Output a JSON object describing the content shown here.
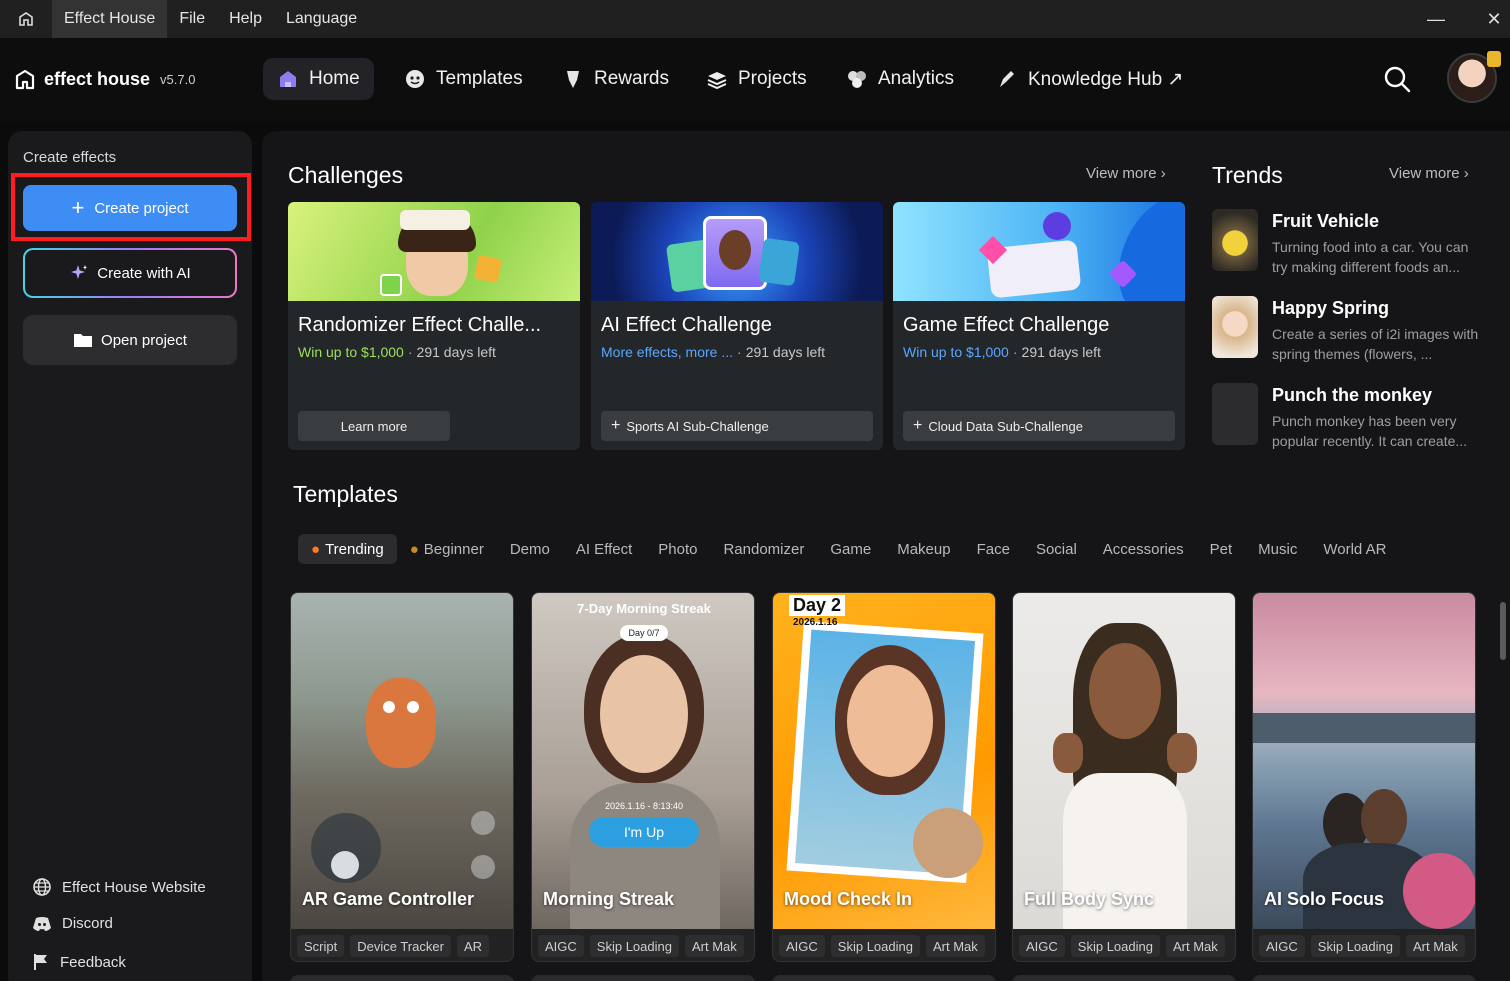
{
  "titlebar": {
    "menus": [
      "Effect House",
      "File",
      "Help",
      "Language"
    ],
    "minimize": "—",
    "close": "✕"
  },
  "header": {
    "logo_name": "effect house",
    "version": "v5.7.0",
    "nav": [
      {
        "label": "Home",
        "icon": "home-icon",
        "active": true
      },
      {
        "label": "Templates",
        "icon": "templates-icon"
      },
      {
        "label": "Rewards",
        "icon": "rewards-icon"
      },
      {
        "label": "Projects",
        "icon": "projects-icon"
      },
      {
        "label": "Analytics",
        "icon": "analytics-icon"
      },
      {
        "label": "Knowledge Hub ↗",
        "icon": "knowledge-hub-icon"
      }
    ]
  },
  "sidebar": {
    "title": "Create effects",
    "create_project": "Create project",
    "create_ai": "Create with AI",
    "open_project": "Open project",
    "links": [
      {
        "label": "Effect House Website",
        "icon": "globe-icon"
      },
      {
        "label": "Discord",
        "icon": "discord-icon"
      },
      {
        "label": "Feedback",
        "icon": "flag-icon"
      }
    ]
  },
  "challenges": {
    "title": "Challenges",
    "view_more": "View more",
    "cards": [
      {
        "title": "Randomizer Effect Challe...",
        "reward": "Win up to $1,000",
        "days": "291 days left",
        "button": "Learn more"
      },
      {
        "title": "AI Effect Challenge",
        "reward": "More effects, more ...",
        "days": "291 days left",
        "button": "Sports AI Sub-Challenge"
      },
      {
        "title": "Game Effect Challenge",
        "reward": "Win up to $1,000",
        "days": "291 days left",
        "button": "Cloud Data Sub-Challenge"
      }
    ]
  },
  "trends": {
    "title": "Trends",
    "view_more": "View more",
    "items": [
      {
        "title": "Fruit Vehicle",
        "desc": "Turning food into a car. You can try making different foods an..."
      },
      {
        "title": "Happy Spring",
        "desc": "Create a series of i2i images with spring themes (flowers, ..."
      },
      {
        "title": "Punch the monkey",
        "desc": "Punch monkey has been very popular recently. It can create..."
      }
    ]
  },
  "templates": {
    "title": "Templates",
    "tabs": [
      "Trending",
      "Beginner",
      "Demo",
      "AI Effect",
      "Photo",
      "Randomizer",
      "Game",
      "Makeup",
      "Face",
      "Social",
      "Accessories",
      "Pet",
      "Music",
      "World AR"
    ],
    "cards": [
      {
        "name": "AR Game Controller",
        "tags": [
          "Script",
          "Device Tracker",
          "AR"
        ]
      },
      {
        "name": "Morning Streak",
        "tags": [
          "AIGC",
          "Skip Loading",
          "Art Mak"
        ],
        "overlay_title": "7-Day Morning Streak",
        "overlay_day": "Day 0/7",
        "overlay_time": "2026.1.16 - 8:13:40",
        "overlay_button": "I'm Up"
      },
      {
        "name": "Mood Check In",
        "tags": [
          "AIGC",
          "Skip Loading",
          "Art Mak"
        ],
        "overlay_day": "Day 2",
        "overlay_date": "2026.1.16"
      },
      {
        "name": "Full Body Sync",
        "tags": [
          "AIGC",
          "Skip Loading",
          "Art Mak"
        ]
      },
      {
        "name": "AI Solo Focus",
        "tags": [
          "AIGC",
          "Skip Loading",
          "Art Mak"
        ]
      }
    ]
  },
  "colors": {
    "accent": "#3e8df4",
    "highlight": "#ff1d22",
    "reward_green": "#9be15d",
    "reward_blue": "#5ba7ff"
  }
}
